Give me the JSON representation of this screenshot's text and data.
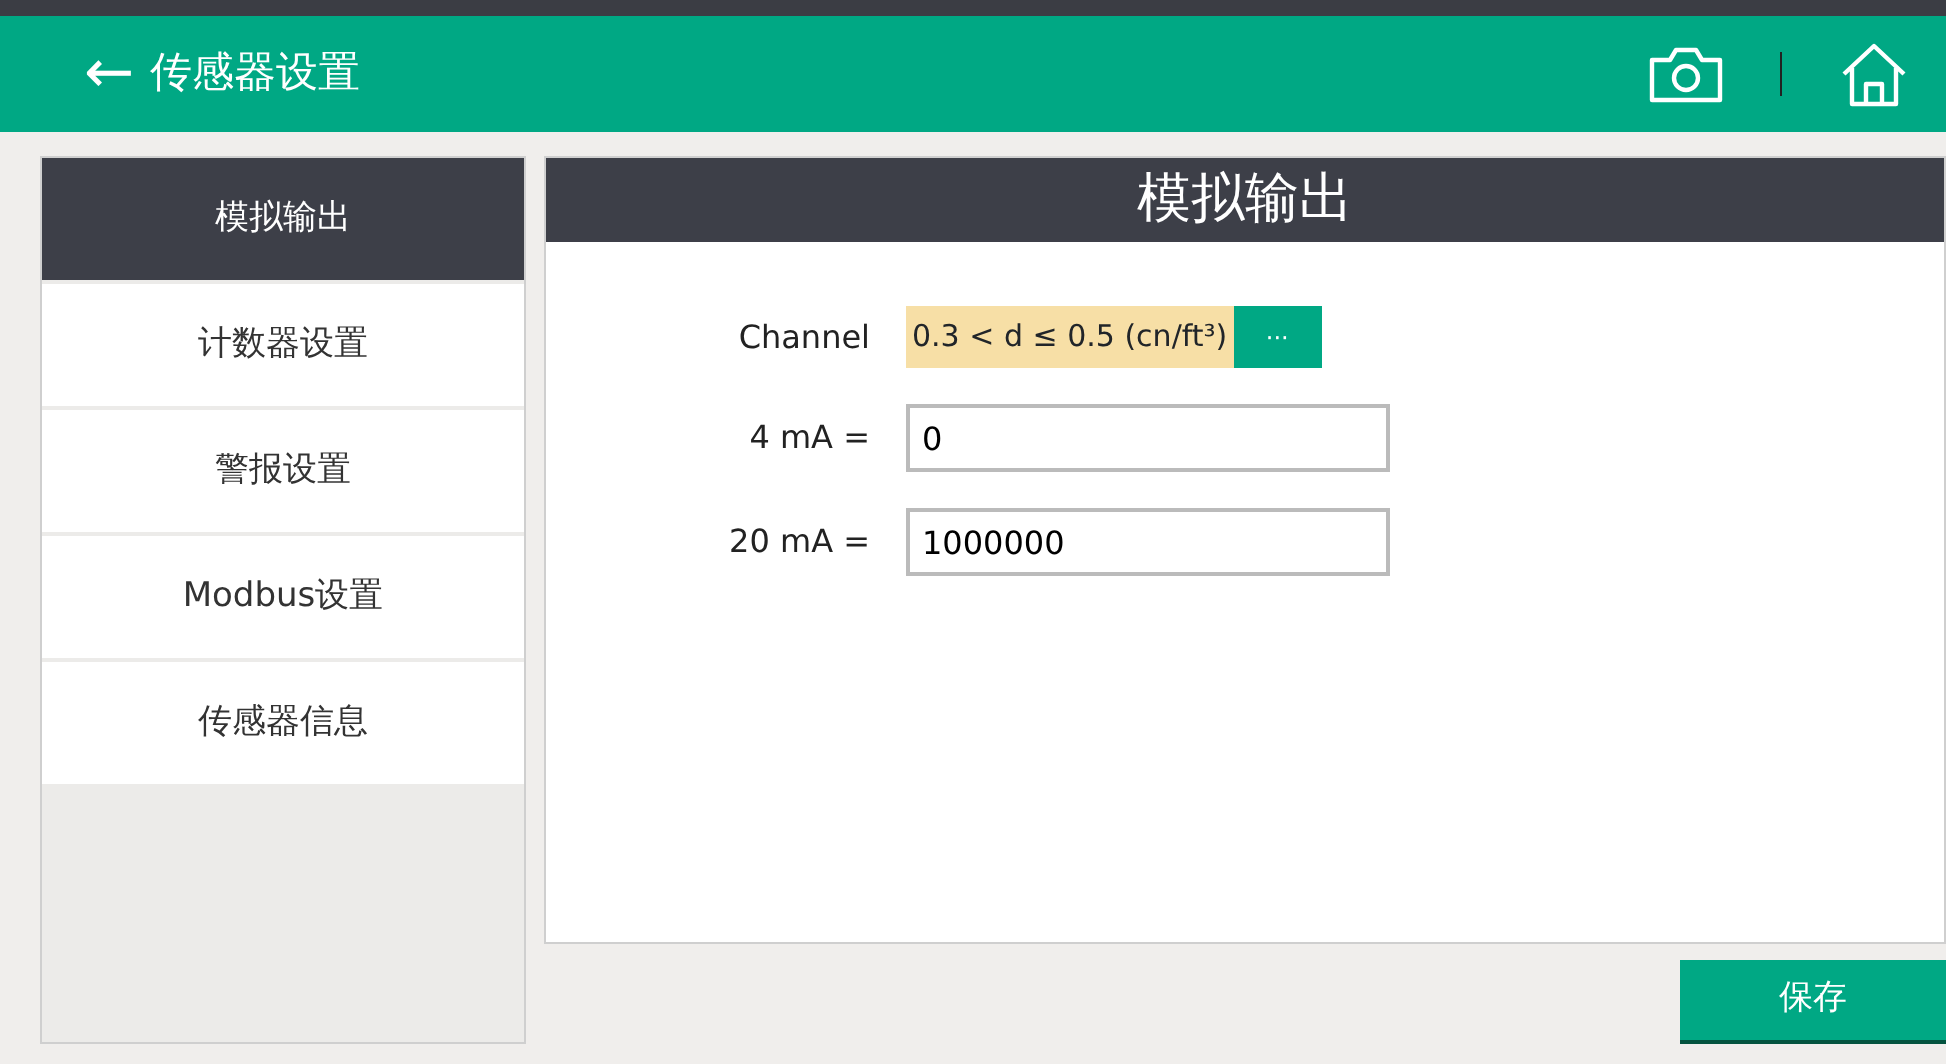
{
  "header": {
    "back": "←",
    "title": "传感器设置"
  },
  "sidebar": {
    "items": [
      {
        "label": "模拟输出",
        "selected": true
      },
      {
        "label": "计数器设置",
        "selected": false
      },
      {
        "label": "警报设置",
        "selected": false
      },
      {
        "label": "Modbus设置",
        "selected": false
      },
      {
        "label": "传感器信息",
        "selected": false
      }
    ]
  },
  "panel": {
    "title": "模拟输出",
    "fields": [
      {
        "kind": "select",
        "label": "Channel",
        "value": "0.3 < d ≤ 0.5 (cn/ft³)",
        "button": "···"
      },
      {
        "kind": "input",
        "label": "4 mA =",
        "value": "0"
      },
      {
        "kind": "input",
        "label": "20 mA =",
        "value": "1000000"
      }
    ]
  },
  "save_button": "保存"
}
